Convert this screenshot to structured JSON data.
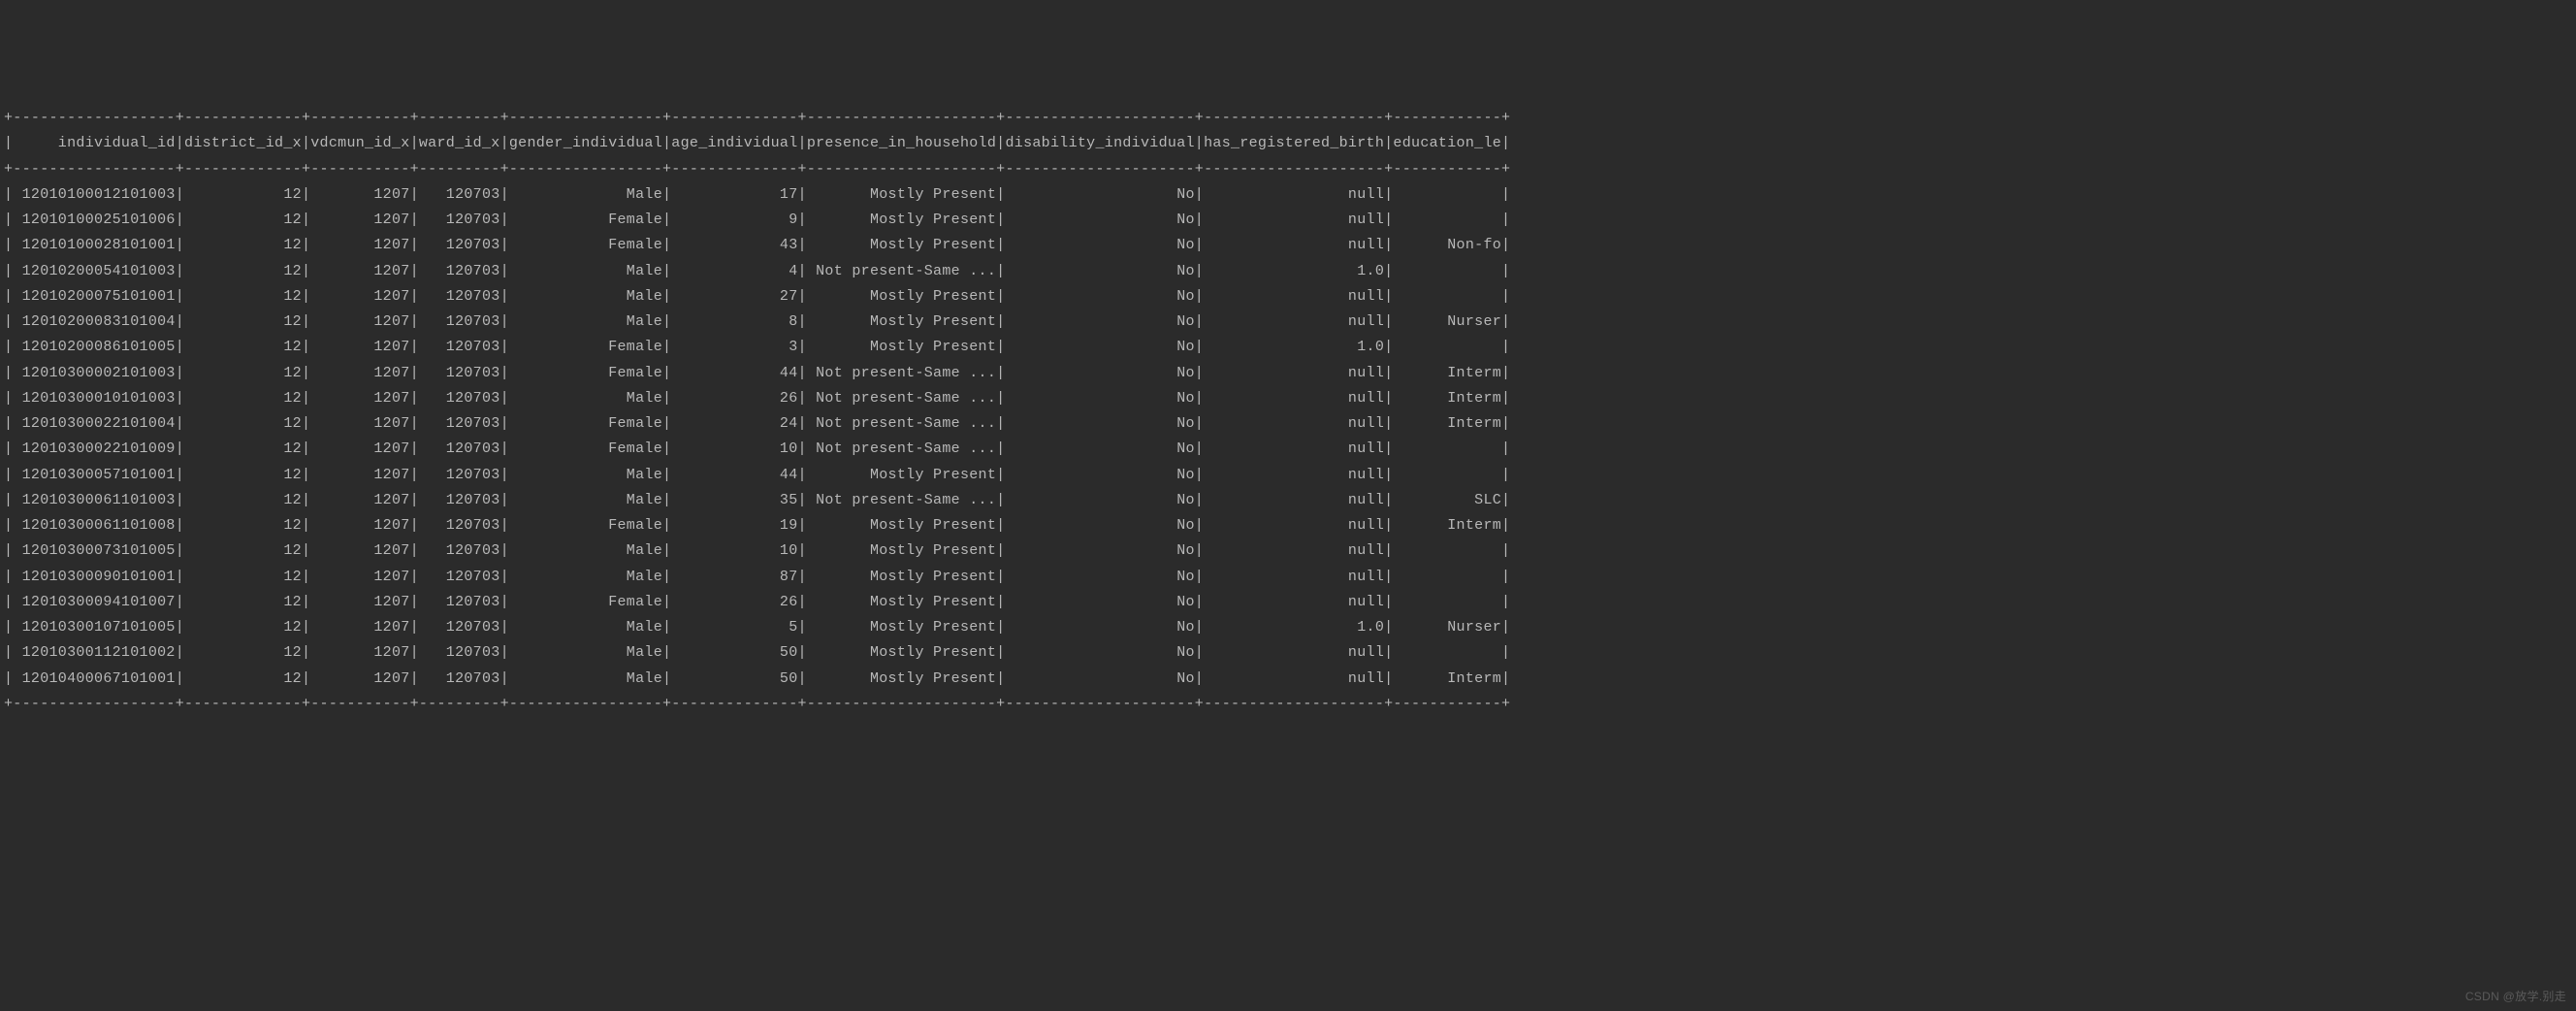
{
  "columns": [
    {
      "name": "individual_id",
      "width": 18,
      "align": "right",
      "leftspace": true
    },
    {
      "name": "district_id_x",
      "width": 13,
      "align": "right"
    },
    {
      "name": "vdcmun_id_x",
      "width": 11,
      "align": "right"
    },
    {
      "name": "ward_id_x",
      "width": 9,
      "align": "right"
    },
    {
      "name": "gender_individual",
      "width": 17,
      "align": "right"
    },
    {
      "name": "age_individual",
      "width": 14,
      "align": "right"
    },
    {
      "name": "presence_in_household",
      "width": 21,
      "align": "right"
    },
    {
      "name": "disability_individual",
      "width": 21,
      "align": "right"
    },
    {
      "name": "has_registered_birth",
      "width": 20,
      "align": "right"
    },
    {
      "name": "education_le",
      "width": 12,
      "align": "right"
    }
  ],
  "rows": [
    [
      "12010100012101003",
      "12",
      "1207",
      "120703",
      "Male",
      "17",
      "Mostly Present",
      "No",
      "null",
      ""
    ],
    [
      "12010100025101006",
      "12",
      "1207",
      "120703",
      "Female",
      "9",
      "Mostly Present",
      "No",
      "null",
      ""
    ],
    [
      "12010100028101001",
      "12",
      "1207",
      "120703",
      "Female",
      "43",
      "Mostly Present",
      "No",
      "null",
      "Non-fo"
    ],
    [
      "12010200054101003",
      "12",
      "1207",
      "120703",
      "Male",
      "4",
      "Not present-Same ...",
      "No",
      "1.0",
      ""
    ],
    [
      "12010200075101001",
      "12",
      "1207",
      "120703",
      "Male",
      "27",
      "Mostly Present",
      "No",
      "null",
      ""
    ],
    [
      "12010200083101004",
      "12",
      "1207",
      "120703",
      "Male",
      "8",
      "Mostly Present",
      "No",
      "null",
      "Nurser"
    ],
    [
      "12010200086101005",
      "12",
      "1207",
      "120703",
      "Female",
      "3",
      "Mostly Present",
      "No",
      "1.0",
      ""
    ],
    [
      "12010300002101003",
      "12",
      "1207",
      "120703",
      "Female",
      "44",
      "Not present-Same ...",
      "No",
      "null",
      "Interm"
    ],
    [
      "12010300010101003",
      "12",
      "1207",
      "120703",
      "Male",
      "26",
      "Not present-Same ...",
      "No",
      "null",
      "Interm"
    ],
    [
      "12010300022101004",
      "12",
      "1207",
      "120703",
      "Female",
      "24",
      "Not present-Same ...",
      "No",
      "null",
      "Interm"
    ],
    [
      "12010300022101009",
      "12",
      "1207",
      "120703",
      "Female",
      "10",
      "Not present-Same ...",
      "No",
      "null",
      ""
    ],
    [
      "12010300057101001",
      "12",
      "1207",
      "120703",
      "Male",
      "44",
      "Mostly Present",
      "No",
      "null",
      ""
    ],
    [
      "12010300061101003",
      "12",
      "1207",
      "120703",
      "Male",
      "35",
      "Not present-Same ...",
      "No",
      "null",
      "SLC"
    ],
    [
      "12010300061101008",
      "12",
      "1207",
      "120703",
      "Female",
      "19",
      "Mostly Present",
      "No",
      "null",
      "Interm"
    ],
    [
      "12010300073101005",
      "12",
      "1207",
      "120703",
      "Male",
      "10",
      "Mostly Present",
      "No",
      "null",
      ""
    ],
    [
      "12010300090101001",
      "12",
      "1207",
      "120703",
      "Male",
      "87",
      "Mostly Present",
      "No",
      "null",
      ""
    ],
    [
      "12010300094101007",
      "12",
      "1207",
      "120703",
      "Female",
      "26",
      "Mostly Present",
      "No",
      "null",
      ""
    ],
    [
      "12010300107101005",
      "12",
      "1207",
      "120703",
      "Male",
      "5",
      "Mostly Present",
      "No",
      "1.0",
      "Nurser"
    ],
    [
      "12010300112101002",
      "12",
      "1207",
      "120703",
      "Male",
      "50",
      "Mostly Present",
      "No",
      "null",
      ""
    ],
    [
      "12010400067101001",
      "12",
      "1207",
      "120703",
      "Male",
      "50",
      "Mostly Present",
      "No",
      "null",
      "Interm"
    ]
  ],
  "watermark": "CSDN @放学.别走"
}
